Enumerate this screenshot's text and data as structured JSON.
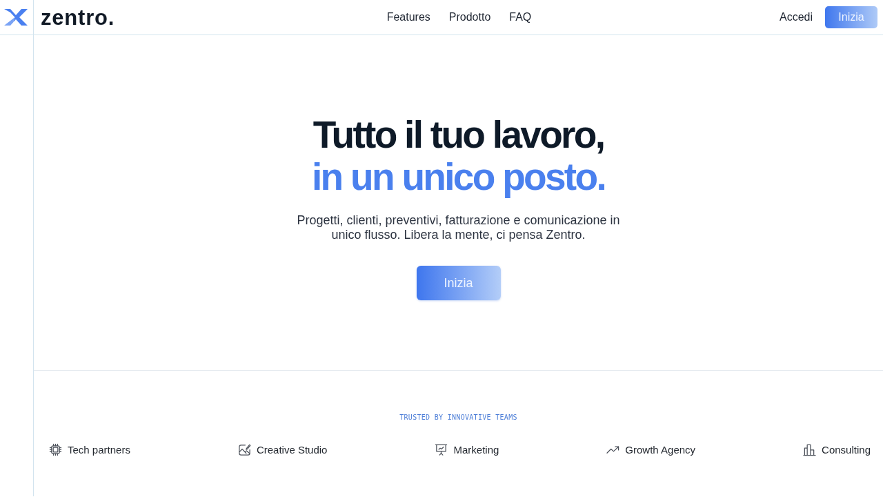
{
  "header": {
    "logo": "zentro.",
    "nav": [
      {
        "label": "Features"
      },
      {
        "label": "Prodotto"
      },
      {
        "label": "FAQ"
      }
    ],
    "login": "Accedi",
    "cta": "Inizia"
  },
  "hero": {
    "title_line_1": "Tutto il tuo lavoro,",
    "title_line_2": "in un unico posto.",
    "subtitle": "Progetti, clienti, preventivi, fatturazione e comunicazione in unico flusso. Libera la mente, ci pensa Zentro.",
    "cta": "Inizia"
  },
  "trusted": {
    "heading": "TRUSTED BY INNOVATIVE TEAMS",
    "logos": [
      {
        "kind": "chip",
        "label": "Tech partners"
      },
      {
        "kind": "image",
        "label": "Creative Studio"
      },
      {
        "kind": "board",
        "label": "Marketing"
      },
      {
        "kind": "trend",
        "label": "Growth Agency"
      },
      {
        "kind": "bars",
        "label": "Consulting"
      }
    ]
  }
}
